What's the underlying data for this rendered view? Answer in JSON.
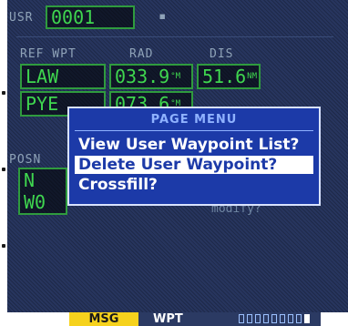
{
  "header": {
    "usr_label": "USR",
    "usr_value": "0001",
    "marker": "▪"
  },
  "columns": {
    "ref_wpt": "REF WPT",
    "rad": "RAD",
    "dis": "DIS"
  },
  "rows": [
    {
      "ref": "LAW",
      "rad": "033.9",
      "rad_unit": "°M",
      "dis": "51.6",
      "dis_unit": "NM"
    },
    {
      "ref": "PYE",
      "rad": "073.6",
      "rad_unit": "°M"
    }
  ],
  "posn": {
    "label": "POSN",
    "lat_prefix": "N",
    "lon_prefix": "W0",
    "note": "modify?"
  },
  "page_menu": {
    "title": "PAGE MENU",
    "items": [
      "View User Waypoint List?",
      "Delete User Waypoint?",
      "Crossfill?"
    ],
    "selected_index": 1
  },
  "status_bar": {
    "msg": "MSG",
    "page_group": "WPT",
    "page_count": 9,
    "active_page": 9
  },
  "colors": {
    "screen": "#27355e",
    "menu": "#1c3aa8",
    "field_text": "#3fd64f",
    "msg": "#f6d21d"
  }
}
